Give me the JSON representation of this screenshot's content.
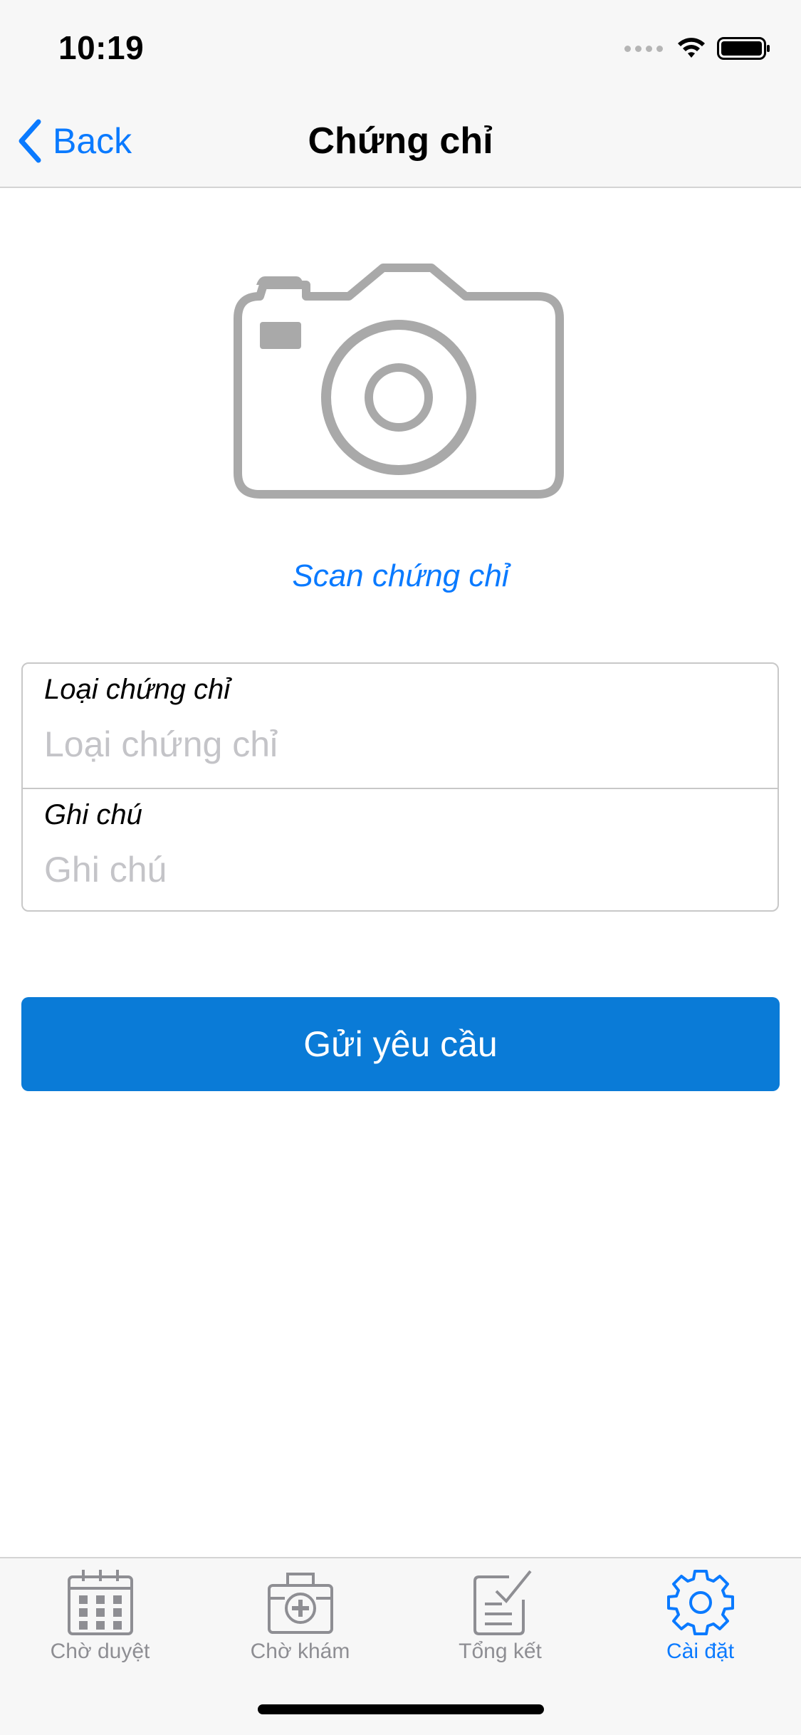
{
  "status_bar": {
    "time": "10:19"
  },
  "nav": {
    "back_label": "Back",
    "title": "Chứng chỉ"
  },
  "scan": {
    "link_label": "Scan chứng chỉ",
    "icon": "camera-icon"
  },
  "form": {
    "certificate_type": {
      "label": "Loại chứng chỉ",
      "placeholder": "Loại chứng chỉ",
      "value": ""
    },
    "note": {
      "label": "Ghi chú",
      "placeholder": "Ghi chú",
      "value": ""
    }
  },
  "submit": {
    "label": "Gửi yêu cầu",
    "color": "#0a7bd7"
  },
  "tab_bar": {
    "items": [
      {
        "label": "Chờ duyệt",
        "icon": "calendar-icon",
        "active": false
      },
      {
        "label": "Chờ khám",
        "icon": "medical-kit-icon",
        "active": false
      },
      {
        "label": "Tổng kết",
        "icon": "checklist-icon",
        "active": false
      },
      {
        "label": "Cài đặt",
        "icon": "gear-icon",
        "active": true
      }
    ]
  },
  "colors": {
    "accent": "#0a7aff",
    "inactive": "#8e8e93",
    "camera_gray": "#a9a9a9"
  }
}
